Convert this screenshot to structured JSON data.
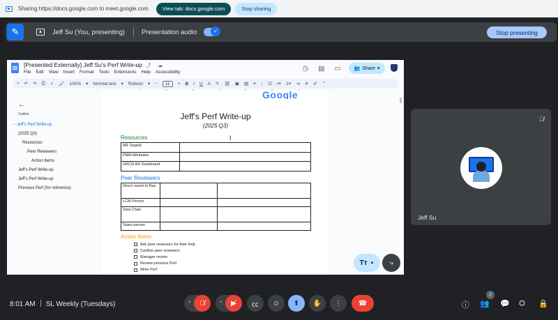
{
  "share_bar": {
    "message": "Sharing https://docs.google.com to meet.google.com",
    "view_tab": "View tab: docs.google.com",
    "stop_sharing": "Stop sharing"
  },
  "present_bar": {
    "presenter": "Jeff Su (You, presenting)",
    "audio_label": "Presentation audio",
    "audio_enabled": true,
    "stop_presenting": "Stop presenting"
  },
  "docs": {
    "title": "[Presented Externally] Jeff Su's Perf Write-up",
    "menus": [
      "File",
      "Edit",
      "View",
      "Insert",
      "Format",
      "Tools",
      "Extensions",
      "Help",
      "Accessibility"
    ],
    "share_label": "Share",
    "toolbar": {
      "zoom": "100%",
      "style": "Normal text",
      "font": "Roboto",
      "font_size": "11"
    },
    "ruler": [
      "1",
      "2",
      "3",
      "4",
      "5",
      "6",
      "7"
    ],
    "outline": {
      "heading": "Outline",
      "items": [
        {
          "label": "Jeff's Perf Write-up",
          "active": true
        },
        {
          "label": "(2025 Q3)"
        },
        {
          "label": "Resources"
        },
        {
          "label": "Peer Reviewers"
        },
        {
          "label": "Action Items"
        },
        {
          "label": "Jeff's Perf Write-up"
        },
        {
          "label": "Jeff's Perf Write-up"
        },
        {
          "label": "Previous Perf (for reference)"
        }
      ]
    },
    "page": {
      "logo_text": "Google",
      "title": "Jeff's Perf Write-up",
      "subtitle": "(2025 Q3)",
      "resources_heading": "Resources",
      "resources_rows": [
        "AR Targets",
        "PMM Attributes",
        "GRCN AR Dashboard"
      ],
      "peer_heading": "Peer Reviewers",
      "peer_rows": [
        "Direct report to Bas",
        "LCM Person",
        "Zara Chan",
        "Sales person"
      ],
      "action_heading": "Action Items",
      "action_items": [
        "Ask peer reviewers for their help",
        "Confirm peer reviewers",
        "Manager review",
        "Review previous Perf",
        "Write Perf"
      ]
    }
  },
  "participant": {
    "name": "Jeff Su"
  },
  "bottom": {
    "time": "8:01 AM",
    "meeting_name": "SL Weekly (Tuesdays)",
    "people_count": "2"
  },
  "colors": {
    "meet_bg": "#202124",
    "accent_blue": "#1a73e8",
    "danger_red": "#ea4335",
    "resources_green": "#188038",
    "peer_blue": "#1a73e8",
    "action_orange": "#f29900"
  }
}
